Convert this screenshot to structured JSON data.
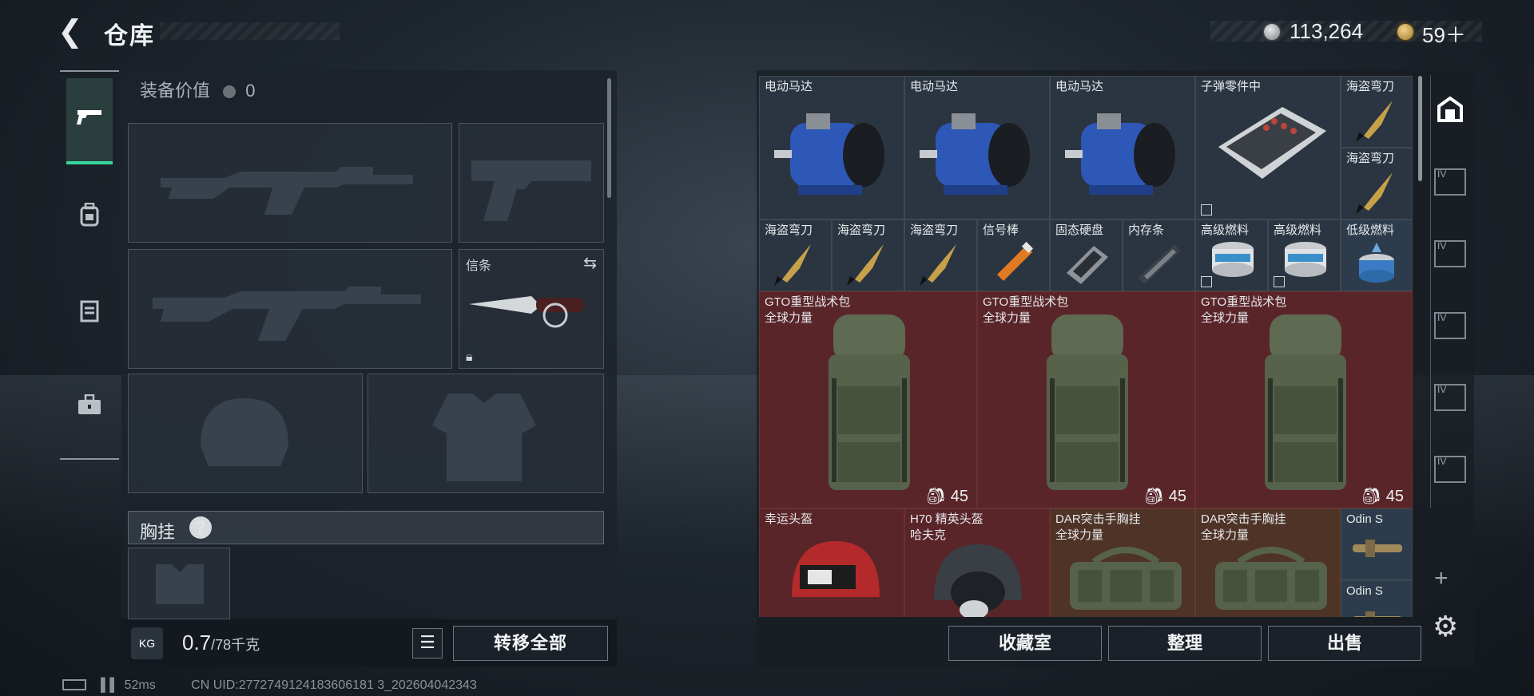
{
  "header": {
    "title": "仓库",
    "currency_silver": "113,264",
    "currency_gold": "59＋"
  },
  "equipment": {
    "value_label": "装备价值",
    "value_amount": "0",
    "melee_slot_label": "信条",
    "chest_rig_label": "胸挂",
    "chest_rig_help": "?"
  },
  "bottom_left": {
    "weight_current": "0.7",
    "weight_max": "/78千克",
    "transfer_all": "转移全部"
  },
  "storage_items": [
    {
      "name": "电动马达",
      "icon": "motor-icon"
    },
    {
      "name": "电动马达",
      "icon": "motor-icon"
    },
    {
      "name": "电动马达",
      "icon": "motor-icon"
    },
    {
      "name": "子弹零件中",
      "icon": "ammo-parts-icon"
    },
    {
      "name": "海盗弯刀",
      "icon": "knife-icon"
    },
    {
      "name": "海盗弯刀",
      "icon": "knife-icon"
    },
    {
      "name": "海盗弯刀",
      "icon": "knife-icon"
    },
    {
      "name": "海盗弯刀",
      "icon": "knife-icon"
    },
    {
      "name": "海盗弯刀",
      "icon": "knife-icon"
    },
    {
      "name": "信号棒",
      "icon": "flare-icon"
    },
    {
      "name": "固态硬盘",
      "icon": "ssd-icon"
    },
    {
      "name": "内存条",
      "icon": "ram-icon"
    },
    {
      "name": "高级燃料",
      "icon": "fuel-can-icon"
    },
    {
      "name": "高级燃料",
      "icon": "fuel-can-icon"
    },
    {
      "name": "低级燃料",
      "icon": "fuel-can-icon"
    },
    {
      "name": "GTO重型战术包",
      "sub": "全球力量",
      "count": "45",
      "icon": "backpack-icon"
    },
    {
      "name": "GTO重型战术包",
      "sub": "全球力量",
      "count": "45",
      "icon": "backpack-icon"
    },
    {
      "name": "GTO重型战术包",
      "sub": "全球力量",
      "count": "45",
      "icon": "backpack-icon"
    },
    {
      "name": "幸运头盔",
      "icon": "helmet-icon"
    },
    {
      "name": "H70 精英头盔",
      "sub": "哈夫克",
      "icon": "helmet-icon"
    },
    {
      "name": "DAR突击手胸挂",
      "sub": "全球力量",
      "icon": "chest-rig-icon"
    },
    {
      "name": "DAR突击手胸挂",
      "sub": "全球力量",
      "icon": "chest-rig-icon"
    },
    {
      "name": "Odin S",
      "icon": "scope-icon"
    },
    {
      "name": "Odin S",
      "icon": "scope-icon"
    }
  ],
  "bottom_right": {
    "collection": "收藏室",
    "organize": "整理",
    "sell": "出售"
  },
  "right_tabs": [
    "IV",
    "IV",
    "IV",
    "IV",
    "IV"
  ],
  "status": {
    "ping": "52ms",
    "uid": "CN UID:2772749124183606181 3_202604042343"
  },
  "colors": {
    "accent_green": "#37d79b",
    "rare_red": "#5a2529",
    "rare_brown": "#4e3326"
  }
}
